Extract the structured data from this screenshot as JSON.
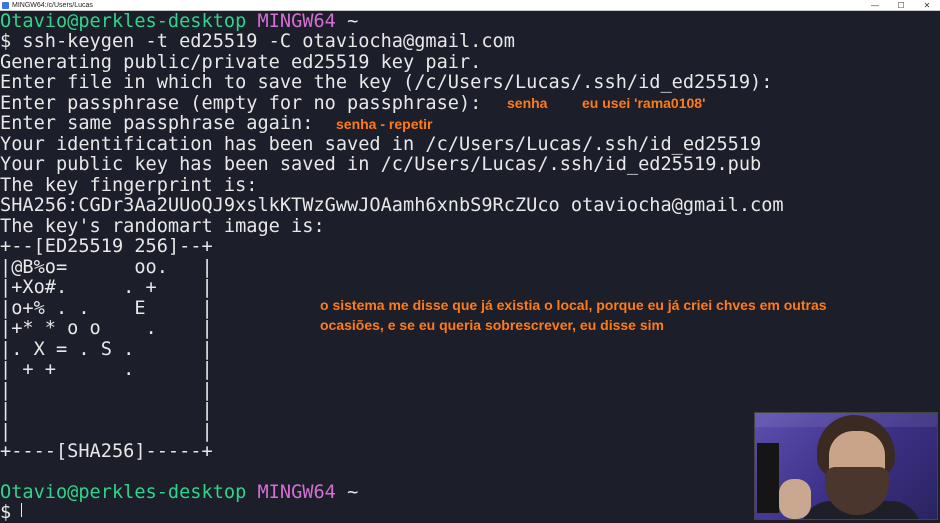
{
  "window": {
    "title": "MINGW64:/c/Users/Lucas",
    "minimize_glyph": "—",
    "maximize_glyph": "☐",
    "close_glyph": "✕"
  },
  "terminal": {
    "prompt1": {
      "user_host": "Otavio@perkles-desktop",
      "shell": "MINGW64",
      "path": "~"
    },
    "lines": [
      "$ ssh-keygen -t ed25519 -C otaviocha@gmail.com",
      "Generating public/private ed25519 key pair.",
      "Enter file in which to save the key (/c/Users/Lucas/.ssh/id_ed25519):",
      "Enter passphrase (empty for no passphrase):",
      "Enter same passphrase again:",
      "Your identification has been saved in /c/Users/Lucas/.ssh/id_ed25519",
      "Your public key has been saved in /c/Users/Lucas/.ssh/id_ed25519.pub",
      "The key fingerprint is:",
      "SHA256:CGDr3Aa2UUoQJ9xslkKTWzGwwJOAamh6xnbS9RcZUco otaviocha@gmail.com",
      "The key's randomart image is:",
      "+--[ED25519 256]--+",
      "|@B%o=      oo.   |",
      "|+Xo#.     . +    |",
      "|o+% . .    E     |",
      "|+* * o o    .    |",
      "|. X = . S .      |",
      "| + +      .      |",
      "|                 |",
      "|                 |",
      "|                 |",
      "+----[SHA256]-----+"
    ],
    "prompt2": {
      "user_host": "Otavio@perkles-desktop",
      "shell": "MINGW64",
      "path": "~"
    },
    "final_prompt": "$"
  },
  "annotations": {
    "passphrase": "senha",
    "passphrase_used": "eu usei 'rama0108'",
    "repeat": "senha - repetir",
    "overwrite_line1": "o sistema me disse que já existia o local, porque eu já criei chves em outras",
    "overwrite_line2": "ocasiões, e se eu queria sobrescrever, eu disse sim"
  },
  "colors": {
    "background": "#1c1f2a",
    "text": "#e8e8e8",
    "prompt_user": "#2fd48a",
    "prompt_shell": "#d36fd2",
    "annotation": "#ff7b1a"
  },
  "icons": {
    "app": "terminal-app-icon",
    "webcam": "webcam-overlay"
  }
}
